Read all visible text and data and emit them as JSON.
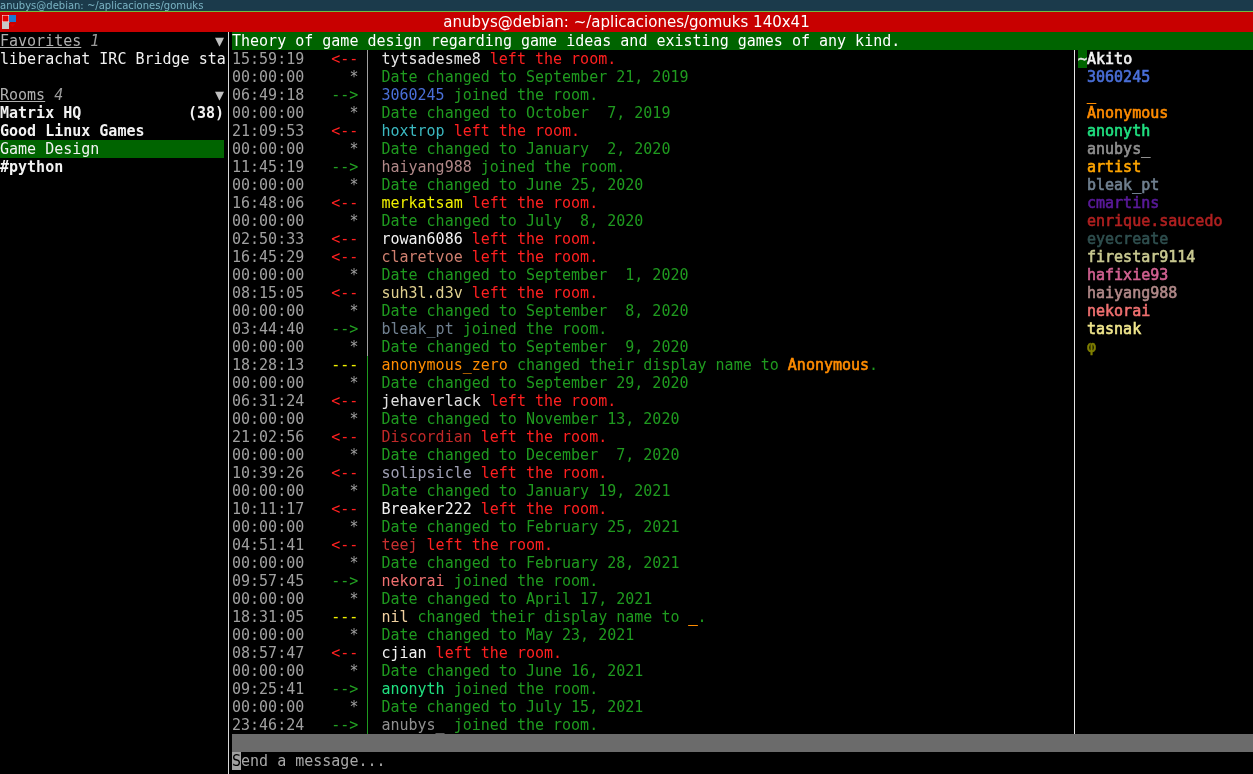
{
  "desktop_bar": {
    "title": "anubys@debian: ~/aplicaciones/gomuks"
  },
  "window": {
    "title": "anubys@debian: ~/aplicaciones/gomuks 140x41"
  },
  "sidebar": {
    "sections": [
      {
        "title": "Favorites",
        "count": "1",
        "toggle": "▼",
        "items": [
          {
            "name": "liberachat IRC Bridge sta",
            "unread": false,
            "selected": false
          }
        ]
      },
      {
        "title": "Rooms",
        "count": "4",
        "toggle": "▼",
        "items": [
          {
            "name": "Matrix HQ",
            "badge": "(38)",
            "unread": true,
            "selected": false
          },
          {
            "name": "Good Linux Games",
            "unread": true,
            "selected": false
          },
          {
            "name": "Game Design",
            "unread": false,
            "selected": true
          },
          {
            "name": "#python",
            "unread": true,
            "selected": false
          }
        ]
      }
    ]
  },
  "room": {
    "topic": "Theory of game design regarding game ideas and existing games of any kind.",
    "messages": [
      {
        "kind": "leave",
        "time": "15:59:19",
        "arrow": "<--",
        "sender": "tytsadesme8",
        "color": "#e6e6e6",
        "text": "left the room.",
        "marked": false
      },
      {
        "kind": "date",
        "time": "00:00:00",
        "arrow": "*",
        "text": "Date changed to September 21, 2019",
        "marked": false
      },
      {
        "kind": "join",
        "time": "06:49:18",
        "arrow": "-->",
        "sender": "3060245",
        "color": "#4a6fd8",
        "text": "joined the room.",
        "marked": false
      },
      {
        "kind": "date",
        "time": "00:00:00",
        "arrow": "*",
        "text": "Date changed to October  7, 2019",
        "marked": false
      },
      {
        "kind": "leave",
        "time": "21:09:53",
        "arrow": "<--",
        "sender": "hoxtrop",
        "color": "#3bb8c0",
        "text": "left the room.",
        "marked": false
      },
      {
        "kind": "date",
        "time": "00:00:00",
        "arrow": "*",
        "text": "Date changed to January  2, 2020",
        "marked": false
      },
      {
        "kind": "join",
        "time": "11:45:19",
        "arrow": "-->",
        "sender": "haiyang988",
        "color": "#b08888",
        "text": "joined the room.",
        "marked": false
      },
      {
        "kind": "date",
        "time": "00:00:00",
        "arrow": "*",
        "text": "Date changed to June 25, 2020",
        "marked": false
      },
      {
        "kind": "leave",
        "time": "16:48:06",
        "arrow": "<--",
        "sender": "merkatsam",
        "color": "#f0f000",
        "text": "left the room.",
        "marked": false
      },
      {
        "kind": "date",
        "time": "00:00:00",
        "arrow": "*",
        "text": "Date changed to July  8, 2020",
        "marked": false
      },
      {
        "kind": "leave",
        "time": "02:50:33",
        "arrow": "<--",
        "sender": "rowan6086",
        "color": "#f2f2f2",
        "text": "left the room.",
        "marked": false
      },
      {
        "kind": "leave",
        "time": "16:45:29",
        "arrow": "<--",
        "sender": "claretvoe",
        "color": "#d08070",
        "text": "left the room.",
        "marked": false
      },
      {
        "kind": "date",
        "time": "00:00:00",
        "arrow": "*",
        "text": "Date changed to September  1, 2020",
        "marked": false
      },
      {
        "kind": "leave",
        "time": "08:15:05",
        "arrow": "<--",
        "sender": "suh3l.d3v",
        "color": "#e0d090",
        "text": "left the room.",
        "marked": false
      },
      {
        "kind": "date",
        "time": "00:00:00",
        "arrow": "*",
        "text": "Date changed to September  8, 2020",
        "marked": false
      },
      {
        "kind": "join",
        "time": "03:44:40",
        "arrow": "-->",
        "sender": "bleak_pt",
        "color": "#708090",
        "text": "joined the room.",
        "marked": false
      },
      {
        "kind": "date",
        "time": "00:00:00",
        "arrow": "*",
        "text": "Date changed to September  9, 2020",
        "marked": false
      },
      {
        "kind": "nick",
        "time": "18:28:13",
        "arrow": "---",
        "sender": "anonymous_zero",
        "color": "#ff8c00",
        "text": "changed their display name to",
        "new_name": {
          "name": "Anonymous",
          "color": "#ff8c00"
        },
        "suffix": ".",
        "marked": true
      },
      {
        "kind": "date",
        "time": "00:00:00",
        "arrow": "*",
        "text": "Date changed to September 29, 2020",
        "marked": true
      },
      {
        "kind": "leave",
        "time": "06:31:24",
        "arrow": "<--",
        "sender": "jehaverlack",
        "color": "#e0e0e0",
        "text": "left the room.",
        "marked": true
      },
      {
        "kind": "date",
        "time": "00:00:00",
        "arrow": "*",
        "text": "Date changed to November 13, 2020",
        "marked": true
      },
      {
        "kind": "leave",
        "time": "21:02:56",
        "arrow": "<--",
        "sender": "Discordian",
        "color": "#c02828",
        "text": "left the room.",
        "marked": true
      },
      {
        "kind": "date",
        "time": "00:00:00",
        "arrow": "*",
        "text": "Date changed to December  7, 2020",
        "marked": true
      },
      {
        "kind": "leave",
        "time": "10:39:26",
        "arrow": "<--",
        "sender": "solipsicle",
        "color": "#a0a0b4",
        "text": "left the room.",
        "marked": true
      },
      {
        "kind": "date",
        "time": "00:00:00",
        "arrow": "*",
        "text": "Date changed to January 19, 2021",
        "marked": true
      },
      {
        "kind": "leave",
        "time": "10:11:17",
        "arrow": "<--",
        "sender": "Breaker222",
        "color": "#f2f2f2",
        "text": "left the room.",
        "marked": true
      },
      {
        "kind": "date",
        "time": "00:00:00",
        "arrow": "*",
        "text": "Date changed to February 25, 2021",
        "marked": true
      },
      {
        "kind": "leave",
        "time": "04:51:41",
        "arrow": "<--",
        "sender": "teej",
        "color": "#c83030",
        "text": "left the room.",
        "marked": true
      },
      {
        "kind": "date",
        "time": "00:00:00",
        "arrow": "*",
        "text": "Date changed to February 28, 2021",
        "marked": true
      },
      {
        "kind": "join",
        "time": "09:57:45",
        "arrow": "-->",
        "sender": "nekorai",
        "color": "#f07070",
        "text": "joined the room.",
        "marked": true
      },
      {
        "kind": "date",
        "time": "00:00:00",
        "arrow": "*",
        "text": "Date changed to April 17, 2021",
        "marked": true
      },
      {
        "kind": "nick",
        "time": "18:31:05",
        "arrow": "---",
        "sender": "nil",
        "color": "#f0d0a0",
        "text": "changed their display name to",
        "new_name": {
          "name": "_",
          "color": "#ff8c00"
        },
        "suffix": ".",
        "marked": true
      },
      {
        "kind": "date",
        "time": "00:00:00",
        "arrow": "*",
        "text": "Date changed to May 23, 2021",
        "marked": true
      },
      {
        "kind": "leave",
        "time": "08:57:47",
        "arrow": "<--",
        "sender": "cjian",
        "color": "#f2f2f2",
        "text": "left the room.",
        "marked": true
      },
      {
        "kind": "date",
        "time": "00:00:00",
        "arrow": "*",
        "text": "Date changed to June 16, 2021",
        "marked": true
      },
      {
        "kind": "join",
        "time": "09:25:41",
        "arrow": "-->",
        "sender": "anonyth",
        "color": "#20e080",
        "text": "joined the room.",
        "marked": true
      },
      {
        "kind": "date",
        "time": "00:00:00",
        "arrow": "*",
        "text": "Date changed to July 15, 2021",
        "marked": true
      },
      {
        "kind": "join",
        "time": "23:46:24",
        "arrow": "-->",
        "sender": "anubys_",
        "color": "#909090",
        "text": "joined the room.",
        "marked": true
      }
    ],
    "members": [
      {
        "prefix": "~",
        "name": "Akito",
        "color": "#f2f2f2"
      },
      {
        "name": "3060245",
        "color": "#4a6fd8"
      },
      {
        "name": "_",
        "color": "#ff8c00"
      },
      {
        "name": "Anonymous",
        "color": "#ff8c00"
      },
      {
        "name": "anonyth",
        "color": "#20e080"
      },
      {
        "name": "anubys_",
        "color": "#909090"
      },
      {
        "name": "artist",
        "color": "#ffa500"
      },
      {
        "name": "bleak_pt",
        "color": "#708090"
      },
      {
        "name": "cmartins",
        "color": "#5a1a9a"
      },
      {
        "name": "enrique.saucedo",
        "color": "#b02020"
      },
      {
        "name": "eyecreate",
        "color": "#2f4f4f"
      },
      {
        "name": "firestar9114",
        "color": "#c8c890"
      },
      {
        "name": "hafixie93",
        "color": "#d06090"
      },
      {
        "name": "haiyang988",
        "color": "#b08888"
      },
      {
        "name": "nekorai",
        "color": "#f07070"
      },
      {
        "name": "tasnak",
        "color": "#f0e68c"
      },
      {
        "name": "φ",
        "color": "#808000"
      }
    ],
    "composer": {
      "placeholder": "Send a message..."
    }
  }
}
